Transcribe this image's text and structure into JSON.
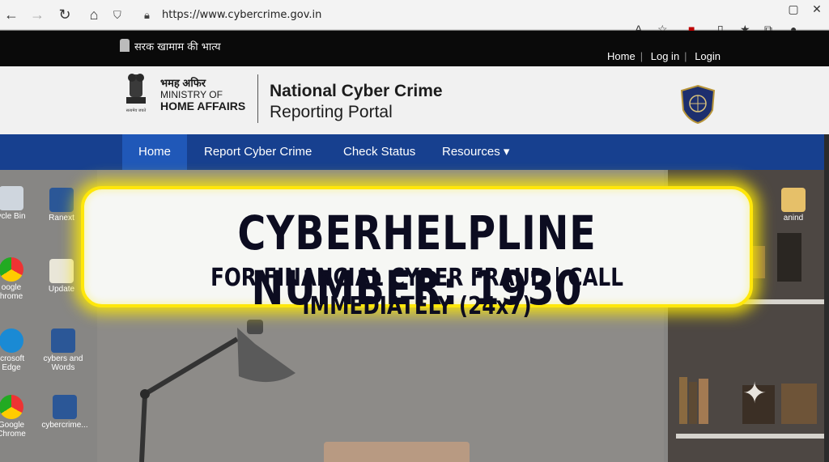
{
  "browser": {
    "url": "https://www.cybercrime.gov.in"
  },
  "gov_bar": {
    "text": "सरक खामाम की भात्य",
    "links": [
      "Home",
      "Log in",
      "Login"
    ]
  },
  "header": {
    "ministry_hi": "भमह अफिर",
    "ministry_line1": "MINISTRY OF",
    "ministry_line2": "HOME AFFAIRS",
    "emblem_motto": "सत्यमेव जयते",
    "portal_line1": "National Cyber Crime",
    "portal_line2": "Reporting Portal"
  },
  "nav": {
    "items": [
      "Home",
      "Report Cyber Crime",
      "Check Status",
      "Resources ▾"
    ]
  },
  "desktop_icons": [
    {
      "label": "ycle Bin"
    },
    {
      "label": "Ranext"
    },
    {
      "label": "oogle\nhrome"
    },
    {
      "label": "Update"
    },
    {
      "label": "icrosoft\nEdge"
    },
    {
      "label": "cybers and\nWords"
    },
    {
      "label": "Google\nChrome"
    },
    {
      "label": "cybercrime..."
    },
    {
      "label": "anind"
    }
  ],
  "banner": {
    "line1": "CYBERHELPLINE NUMBER: 1930",
    "line2": "FOR FINANCIAL CYBER FRAUD | CALL IMMEDIATELY (24x7)"
  },
  "colors": {
    "nav_bg": "#17408f",
    "nav_active": "#2058b8",
    "banner_glow": "#ffe70a",
    "gov_bar": "#0a0a0a"
  }
}
